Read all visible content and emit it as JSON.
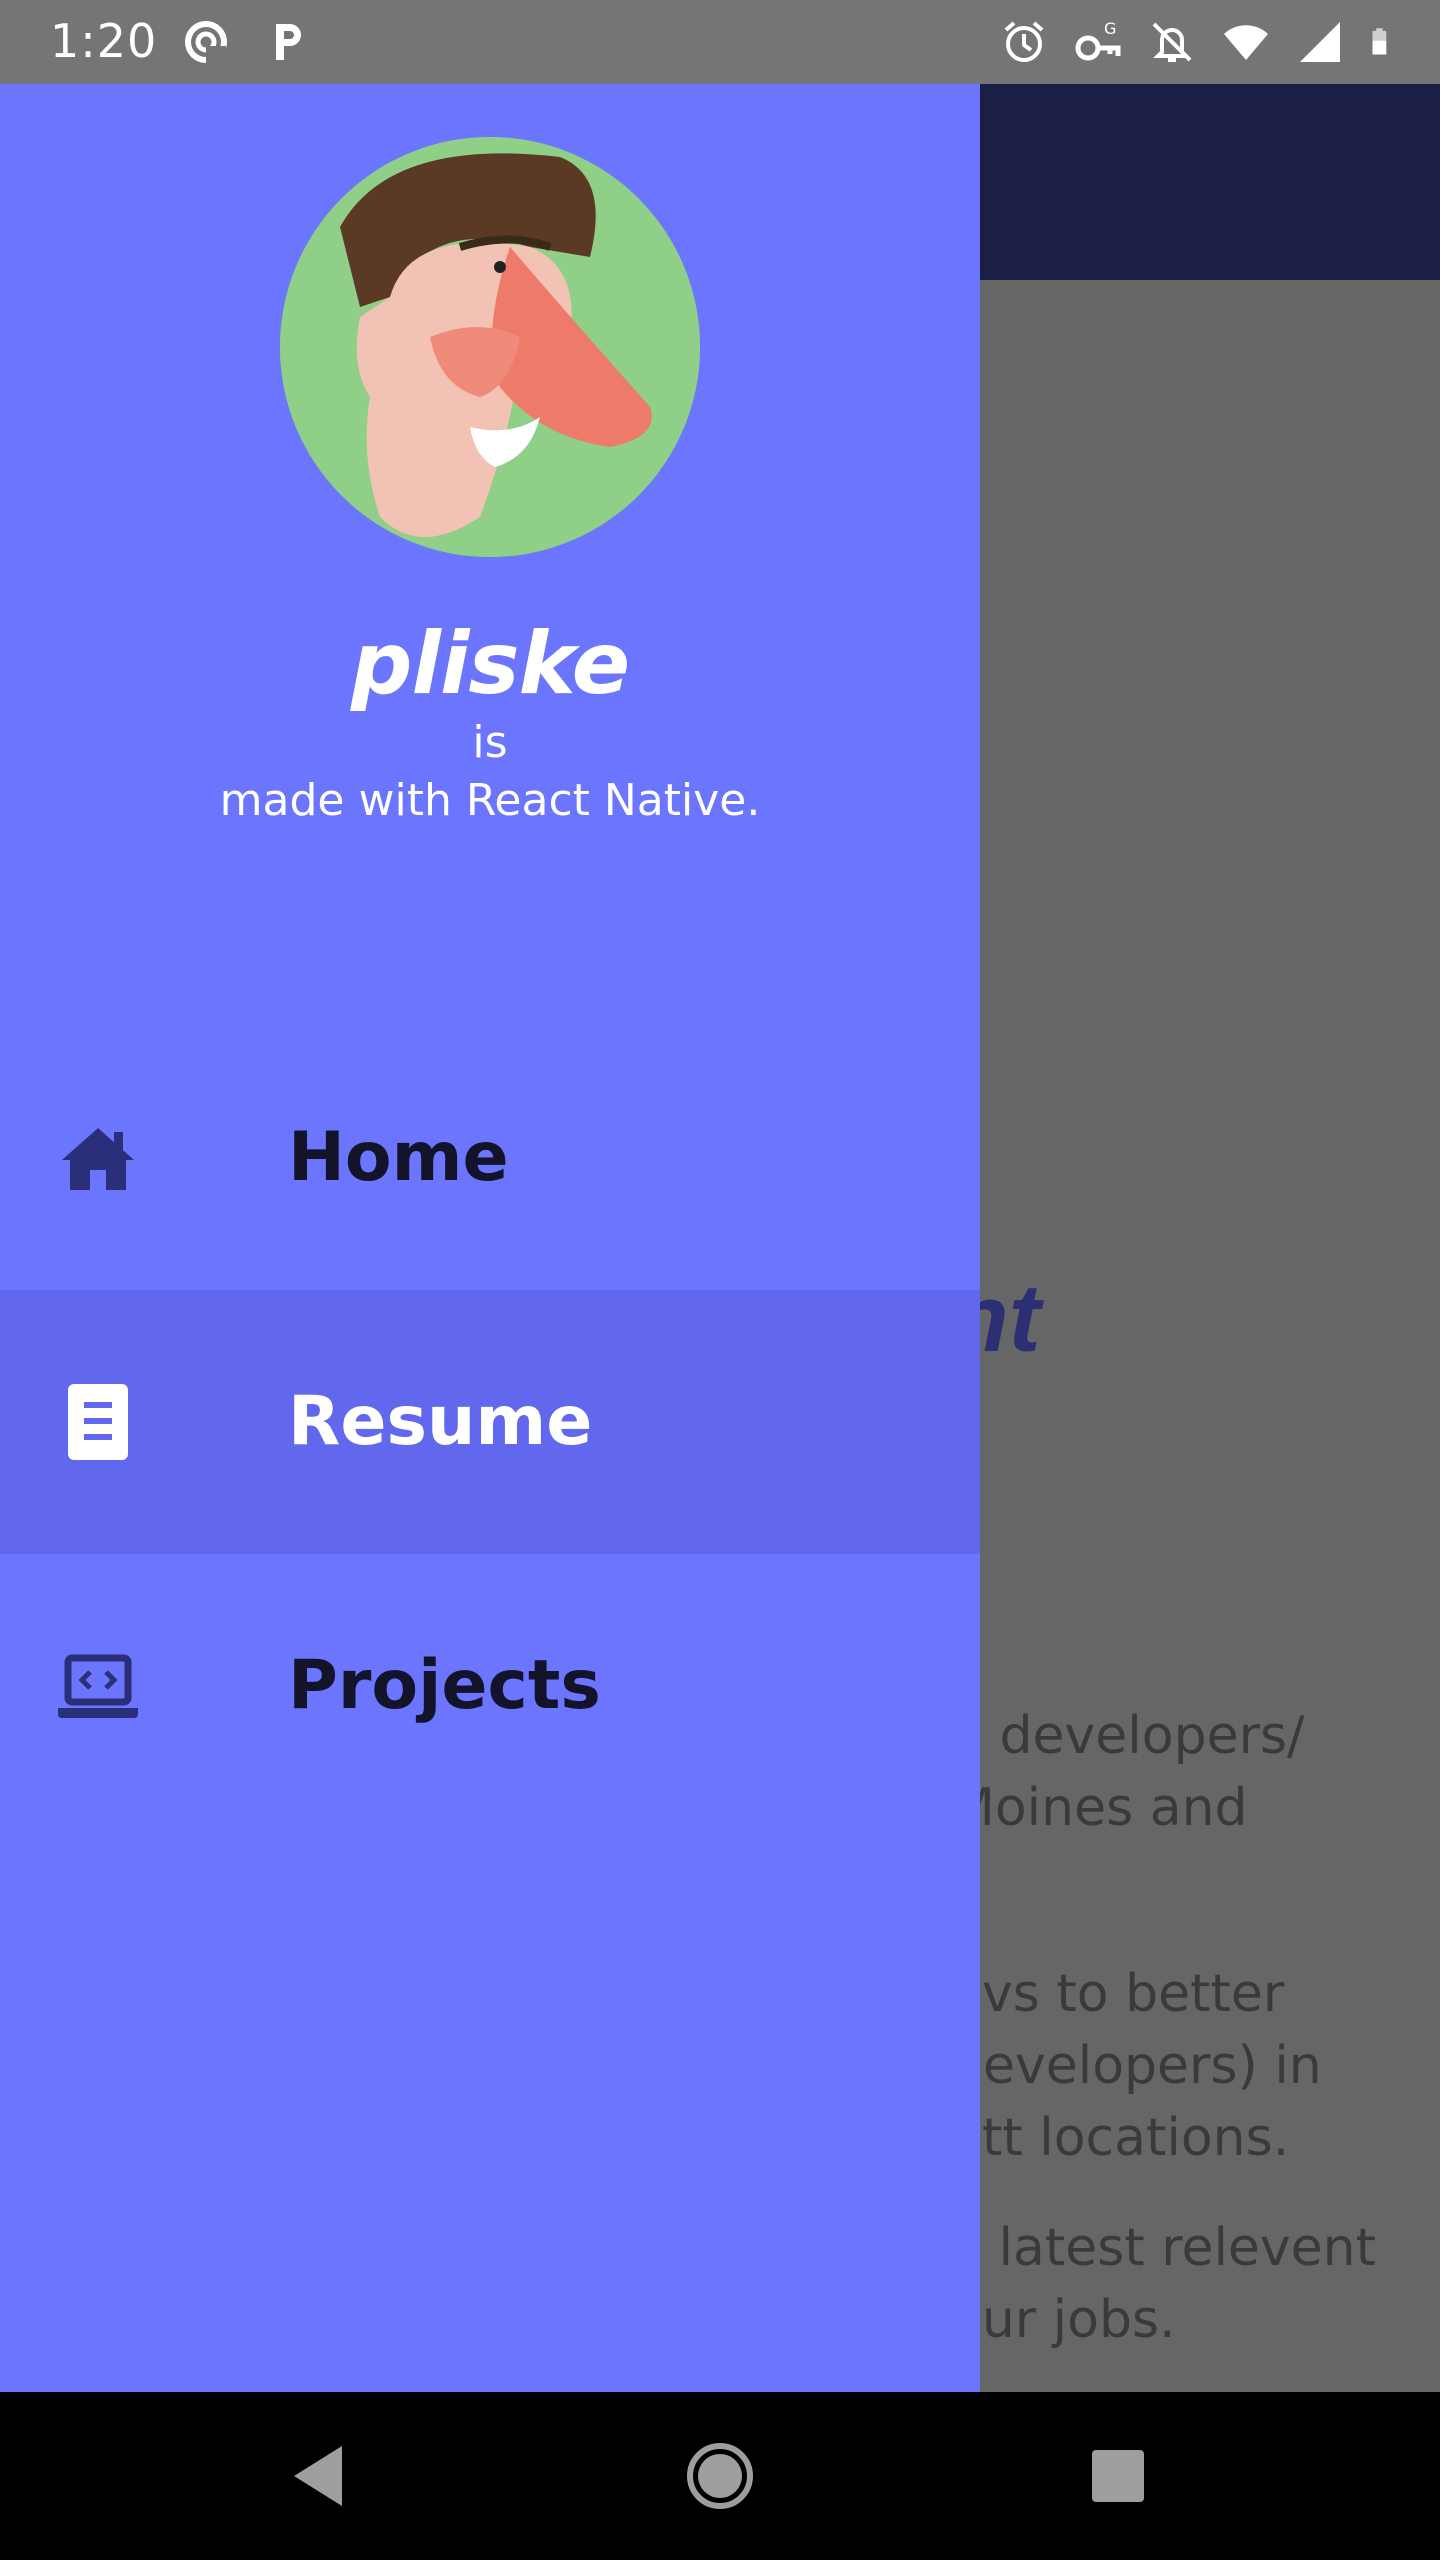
{
  "status_bar": {
    "time": "1:20",
    "left_icons": [
      "sync-icon",
      "parking-icon"
    ],
    "right_icons": [
      "alarm-icon",
      "vpn-key-icon",
      "notifications-off-icon",
      "wifi-icon",
      "signal-icon",
      "battery-icon"
    ]
  },
  "drawer": {
    "brand": "pliske",
    "tagline_line1": "is",
    "tagline_line2": "made with React Native.",
    "items": [
      {
        "label": "Home",
        "icon": "home-icon",
        "active": false
      },
      {
        "label": "Resume",
        "icon": "document-icon",
        "active": true
      },
      {
        "label": "Projects",
        "icon": "laptop-code-icon",
        "active": false
      }
    ],
    "colors": {
      "drawer_bg": "#6b75fe",
      "active_bg": "#6168ee",
      "icon": "#2b2f7a"
    }
  },
  "background_app": {
    "heading_fragment": "nt",
    "text_fragments": [
      "d developers/",
      "Moines and",
      "evs to better",
      "developers) in",
      "ett locations.",
      "e latest relevent",
      "our jobs."
    ],
    "header_color": "#1b1f45"
  },
  "nav_bar": {
    "buttons": [
      "back-icon",
      "home-circle-icon",
      "recents-icon"
    ]
  }
}
